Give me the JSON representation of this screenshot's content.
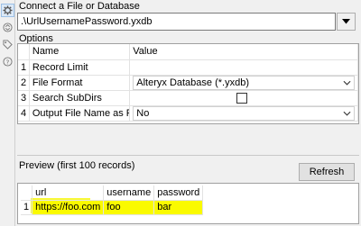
{
  "rail": {
    "icons": [
      "gear-icon",
      "arrows-icon",
      "tag-icon",
      "help-icon"
    ]
  },
  "connect": {
    "label": "Connect a File or Database",
    "value": ".\\UrlUsernamePassword.yxdb"
  },
  "options": {
    "label": "Options",
    "headers": {
      "name": "Name",
      "value": "Value"
    },
    "rows": [
      {
        "num": "1",
        "name": "Record Limit",
        "value": ""
      },
      {
        "num": "2",
        "name": "File Format",
        "value": "Alteryx Database (*.yxdb)"
      },
      {
        "num": "3",
        "name": "Search SubDirs",
        "value": "",
        "checked": false
      },
      {
        "num": "4",
        "name": "Output File Name as Field",
        "value": "No"
      }
    ]
  },
  "preview": {
    "label": "Preview (first 100 records)",
    "refresh_label": "Refresh",
    "headers": [
      "url",
      "username",
      "password"
    ],
    "rows": [
      {
        "num": "1",
        "cells": [
          "https://foo.com",
          "foo",
          "bar"
        ]
      }
    ],
    "highlight_color": "#fafa00"
  }
}
